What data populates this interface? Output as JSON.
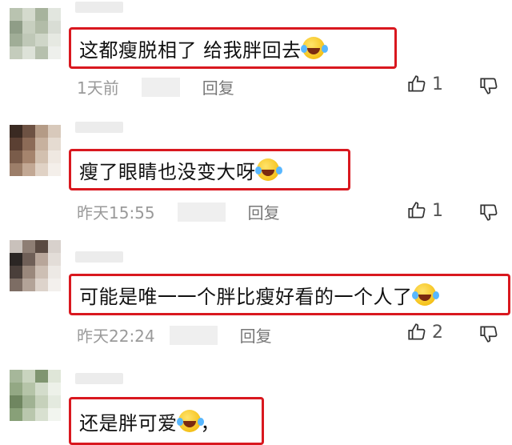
{
  "comments": [
    {
      "text": "这都瘦脱相了 给我胖回去",
      "time": "1天前",
      "reply_label": "回复",
      "likes": "1",
      "avatar": [
        "#b9c3b0",
        "#d4dacd",
        "#a7b39d",
        "#e2e6df",
        "#8f9d87",
        "#c7cfbf",
        "#b2bca8",
        "#d9ddd5",
        "#a0ad97",
        "#bfc8b7",
        "#cfd6c8",
        "#e6e9e2",
        "#c4ccbc",
        "#dde2d8",
        "#b6c0ad",
        "#eef0ec"
      ]
    },
    {
      "text": "瘦了眼睛也没变大呀",
      "time": "昨天15:55",
      "reply_label": "回复",
      "likes": "1",
      "avatar": [
        "#3a2a22",
        "#6d5243",
        "#b49b86",
        "#d8c9bb",
        "#5b4033",
        "#8c6b57",
        "#c7b19e",
        "#e5dbd1",
        "#7a5c4a",
        "#a5846d",
        "#d2c0af",
        "#efe8e1",
        "#9c7e69",
        "#c2a894",
        "#e0d2c5",
        "#f4efea"
      ]
    },
    {
      "text": "可能是唯一一个胖比瘦好看的一个人了",
      "time": "昨天22:24",
      "reply_label": "回复",
      "likes": "2",
      "avatar": [
        "#c9c1bb",
        "#8e7e74",
        "#5a4a42",
        "#d8d1cc",
        "#2b2624",
        "#6f5f57",
        "#b8a69a",
        "#e3ddd8",
        "#4a3f3a",
        "#9a887c",
        "#cdbfb4",
        "#ede9e5",
        "#7d6d64",
        "#b3a398",
        "#ddd3cb",
        "#f3f0ed"
      ]
    },
    {
      "text": "还是胖可爱",
      "text_suffix": "，",
      "time": "",
      "reply_label": "",
      "likes": "",
      "avatar": [
        "#a6b79a",
        "#c9d4bf",
        "#7f9570",
        "#dfe6d8",
        "#93a884",
        "#b5c4a8",
        "#d3dccb",
        "#edf1e9",
        "#6f8660",
        "#a0b293",
        "#c6d1bb",
        "#e4eadf",
        "#88a078",
        "#b9c7ad",
        "#d8e0d0",
        "#f2f5ef"
      ]
    }
  ],
  "colors": {
    "highlight_border": "#d9181f",
    "meta_text": "#9a9a9a"
  },
  "icons": {
    "like": "thumbs-up-icon",
    "dislike": "thumbs-down-icon",
    "emoji": "rofl-emoji-icon"
  }
}
